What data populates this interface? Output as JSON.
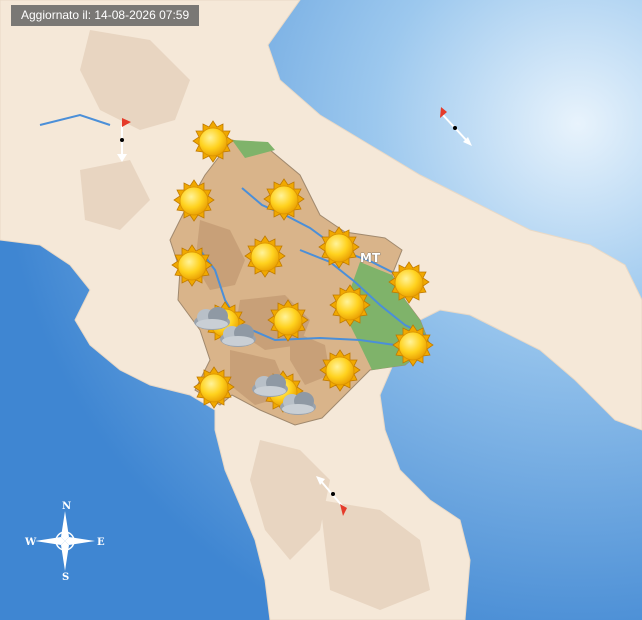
{
  "header": {
    "updated_label": "Aggiornato il: 14-08-2026 07:59"
  },
  "map": {
    "province_label": "MT",
    "colors": {
      "sea": "#4a8fd6",
      "land": "#f5e8d8",
      "region": "#d9b48a",
      "plain": "#7fb36a",
      "river": "#4b8fd8"
    },
    "sun_icon": "sunny-icon",
    "cloud_icon": "partly-cloudy-icon",
    "wind_icon": "wind-arrow-icon"
  },
  "compass": {
    "north": "N",
    "south": "S",
    "east": "E",
    "west": "W"
  }
}
